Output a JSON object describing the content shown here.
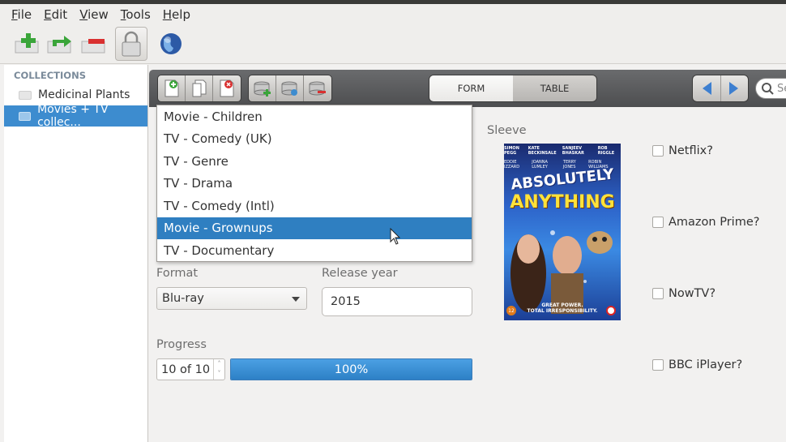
{
  "menubar": {
    "items": [
      {
        "key": "F",
        "rest": "ile"
      },
      {
        "key": "E",
        "rest": "dit"
      },
      {
        "key": "V",
        "rest": "iew"
      },
      {
        "key": "T",
        "rest": "ools"
      },
      {
        "key": "H",
        "rest": "elp"
      }
    ]
  },
  "toolbar": {
    "icons": [
      "add-icon",
      "move-icon",
      "remove-icon",
      "lock-icon",
      "globe-icon"
    ]
  },
  "sidebar": {
    "header": "COLLECTIONS",
    "items": [
      {
        "label": "Medicinal Plants",
        "selected": false
      },
      {
        "label": "Movies + TV collec...",
        "selected": true
      }
    ]
  },
  "viewswitch": {
    "form": "FORM",
    "table": "TABLE",
    "active": "FORM"
  },
  "search": {
    "placeholder": "Se"
  },
  "dropdown": {
    "items": [
      "Movie - Children",
      "TV - Comedy (UK)",
      "TV - Genre",
      "TV - Drama",
      "TV - Comedy (Intl)",
      "Movie - Grownups",
      "TV - Documentary"
    ],
    "highlighted": "Movie - Grownups"
  },
  "form": {
    "format_label": "Format",
    "format_value": "Blu-ray",
    "release_label": "Release year",
    "release_value": "2015",
    "progress_label": "Progress",
    "progress_value": "10 of 10",
    "progress_text": "100%",
    "progress_fraction": 1.0,
    "sleeve_label": "Sleeve"
  },
  "poster": {
    "cast": [
      "SIMON PEGG",
      "KATE BECKINSALE",
      "SANJEEV BHASKAR",
      "ROB RIGGLE"
    ],
    "cast2": [
      "EDDIE IZZARD",
      "JOANNA LUMLEY",
      "TERRY JONES",
      "ROBIN WILLIAMS"
    ],
    "title1": "ABSOLUTELY",
    "title2": "ANYTHING",
    "tagline1": "GREAT POWER.",
    "tagline2": "TOTAL IRRESPONSIBILITY.",
    "rating": "12"
  },
  "checkboxes": [
    {
      "label": "Netflix?",
      "checked": false
    },
    {
      "label": "Amazon Prime?",
      "checked": false
    },
    {
      "label": "NowTV?",
      "checked": false
    },
    {
      "label": "BBC iPlayer?",
      "checked": false
    }
  ],
  "colors": {
    "selection": "#3d8ccf",
    "highlight": "#2f7fc1",
    "progress": "#2d80c6"
  }
}
